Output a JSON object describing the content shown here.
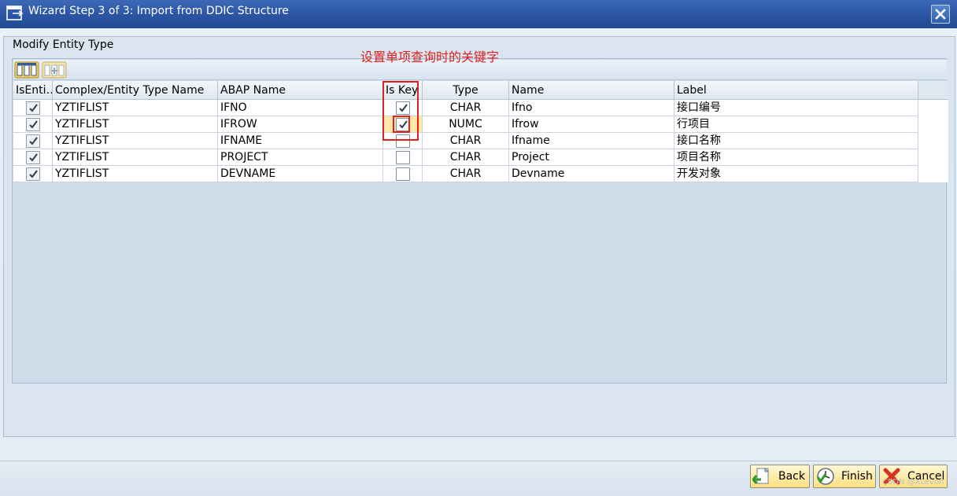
{
  "window": {
    "title": "Wizard Step 3 of 3: Import from DDIC Structure",
    "app_icon": "import-wizard-icon",
    "close_icon": "close-icon"
  },
  "group": {
    "title": "Modify Entity Type"
  },
  "annotation": {
    "text": "设置单项查询时的关键字",
    "color": "#e0211e"
  },
  "toolbar": {
    "buttons": [
      {
        "icon": "select-all-icon"
      },
      {
        "icon": "deselect-all-icon"
      }
    ]
  },
  "table": {
    "columns": [
      "IsEnti…",
      "Complex/Entity Type Name",
      "ABAP Name",
      "Is Key",
      "Type",
      "Name",
      "Label"
    ],
    "rows": [
      {
        "is_entity": true,
        "type_name": "YZTIFLIST",
        "abap_name": "IFNO",
        "is_key": true,
        "type": "CHAR",
        "name": "Ifno",
        "label": "接口编号"
      },
      {
        "is_entity": true,
        "type_name": "YZTIFLIST",
        "abap_name": "IFROW",
        "is_key": true,
        "type": "NUMC",
        "name": "Ifrow",
        "label": "行项目"
      },
      {
        "is_entity": true,
        "type_name": "YZTIFLIST",
        "abap_name": "IFNAME",
        "is_key": false,
        "type": "CHAR",
        "name": "Ifname",
        "label": "接口名称"
      },
      {
        "is_entity": true,
        "type_name": "YZTIFLIST",
        "abap_name": "PROJECT",
        "is_key": false,
        "type": "CHAR",
        "name": "Project",
        "label": "项目名称"
      },
      {
        "is_entity": true,
        "type_name": "YZTIFLIST",
        "abap_name": "DEVNAME",
        "is_key": false,
        "type": "CHAR",
        "name": "Devname",
        "label": "开发对象"
      }
    ]
  },
  "footer": {
    "back_label": "Back",
    "finish_label": "Finish",
    "cancel_label": "Cancel"
  },
  "watermark": "CSDN @XLevon",
  "colors": {
    "titlebar": "#2b55a3",
    "button_face": "#ffe9a0",
    "annotation": "#e0211e"
  }
}
